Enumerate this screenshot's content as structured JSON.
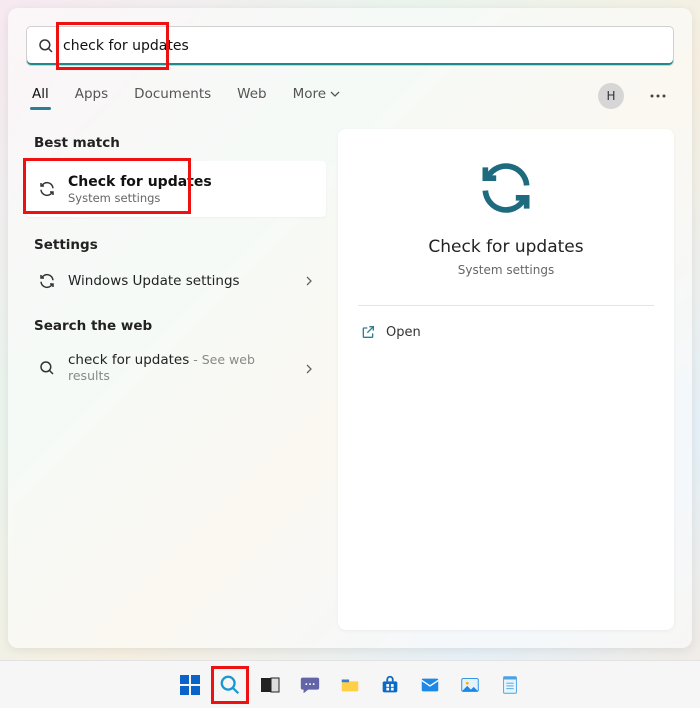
{
  "search": {
    "value": "check for updates"
  },
  "tabs": {
    "all": "All",
    "apps": "Apps",
    "documents": "Documents",
    "web": "Web",
    "more": "More"
  },
  "user": {
    "initial": "H"
  },
  "sections": {
    "best_match": "Best match",
    "settings": "Settings",
    "search_web": "Search the web"
  },
  "best": {
    "title": "Check for updates",
    "subtitle": "System settings"
  },
  "settings_items": [
    {
      "label": "Windows Update settings"
    }
  ],
  "web_items": [
    {
      "label": "check for updates",
      "trail": " - See web results"
    }
  ],
  "preview": {
    "title": "Check for updates",
    "subtitle": "System settings",
    "open": "Open"
  }
}
